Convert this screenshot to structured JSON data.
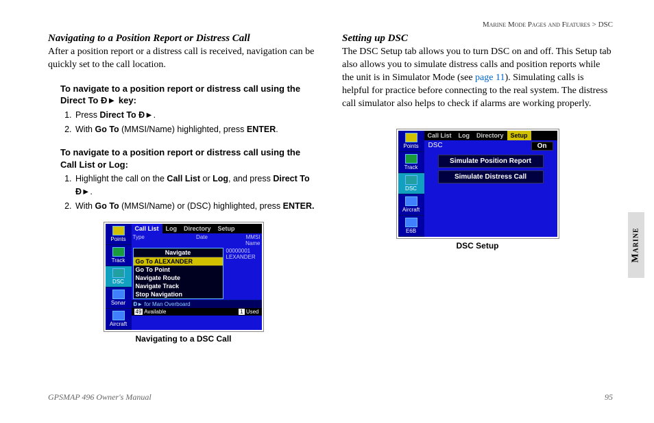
{
  "breadcrumb": {
    "a": "Marine Mode Pages and Features",
    "b": "DSC"
  },
  "left": {
    "h": "Navigating to a Position Report or Distress Call",
    "intro": "After a position report or a distress call is received, navigation can be quickly set to the call location.",
    "proc1_head_a": "To navigate to a position report or distress call using the Direct To ",
    "proc1_head_b": " key:",
    "proc1_s1a": "Press ",
    "proc1_s1b": "Direct To ",
    "proc1_s1c": ".",
    "proc1_s2a": "With ",
    "proc1_s2b": "Go To",
    "proc1_s2c": " (MMSI/Name) highlighted, press ",
    "proc1_s2d": "ENTER",
    "proc1_s2e": ".",
    "proc2_head": "To navigate to a position report or distress call using the Call List or Log:",
    "proc2_s1a": "Highlight the call on the ",
    "proc2_s1b": "Call List",
    "proc2_s1c": " or ",
    "proc2_s1d": "Log",
    "proc2_s1e": ", and press ",
    "proc2_s1f": "Direct To ",
    "proc2_s1g": ".",
    "proc2_s2a": "With ",
    "proc2_s2b": "Go To",
    "proc2_s2c": " (MMSI/Name) or (DSC) highlighted, press ",
    "proc2_s2d": "ENTER.",
    "fig1_caption": "Navigating to a DSC Call"
  },
  "right": {
    "h": "Setting up DSC",
    "p_a": "The DSC Setup tab allows you to turn DSC on and off. This Setup tab also allows you to simulate distress calls and position reports while the unit is in Simulator Mode (see ",
    "p_link": "page 11",
    "p_b": "). Simulating calls is helpful for practice before connecting to the real system. The distress call simulator also helps to check if alarms are working properly.",
    "fig2_caption": "DSC Setup"
  },
  "dev1": {
    "tabs": [
      "Call List",
      "Log",
      "Directory",
      "Setup"
    ],
    "side": [
      "Points",
      "Track",
      "DSC",
      "Sonar",
      "Aircraft"
    ],
    "type": "Type",
    "date": "Date",
    "mmsi": "MMSI",
    "name": "Name",
    "nav": "Navigate",
    "m1": "Go To ALEXANDER",
    "m2": "Go To Point",
    "m3": "Navigate Route",
    "m4": "Navigate Track",
    "m5": "Stop Navigation",
    "r1": "00000001",
    "r2": "LEXANDER",
    "mob": "for Man Overboard",
    "f1": "49",
    "f2": "Available",
    "f3": "1",
    "f4": "Used"
  },
  "dev2": {
    "tabs": [
      "Call List",
      "Log",
      "Directory",
      "Setup"
    ],
    "side": [
      "Points",
      "Track",
      "DSC",
      "Aircraft",
      "E6B"
    ],
    "l1": "DSC",
    "l1v": "On",
    "b1": "Simulate Position Report",
    "b2": "Simulate Distress Call"
  },
  "sidetab": "Marine",
  "footer": {
    "left": "GPSMAP 496 Owner's Manual",
    "right": "95"
  }
}
